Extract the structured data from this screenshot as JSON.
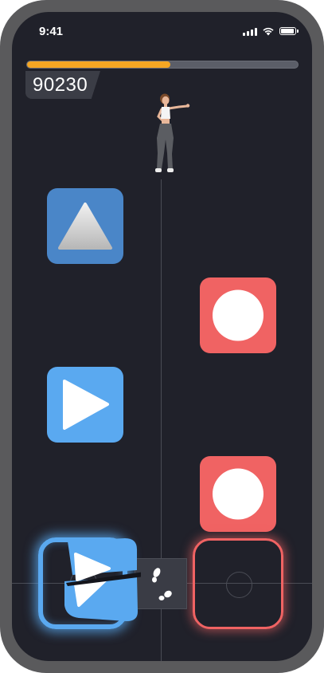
{
  "status_bar": {
    "time": "9:41"
  },
  "game": {
    "score": "90230",
    "progress_fraction": 0.53
  },
  "colors": {
    "progress": "#f5a623",
    "triangle_note": "#4a86c8",
    "circle_note": "#f06363",
    "play_note": "#5aa9f0",
    "background": "#20212a"
  },
  "notes": [
    {
      "shape": "triangle",
      "icon": "triangle-icon",
      "lane": "left"
    },
    {
      "shape": "circle",
      "icon": "circle-icon",
      "lane": "right"
    },
    {
      "shape": "play",
      "icon": "play-icon",
      "lane": "left"
    },
    {
      "shape": "circle",
      "icon": "circle-icon",
      "lane": "right"
    }
  ],
  "targets": [
    {
      "lane": "left",
      "state": "hit"
    },
    {
      "lane": "right",
      "state": "idle"
    }
  ]
}
